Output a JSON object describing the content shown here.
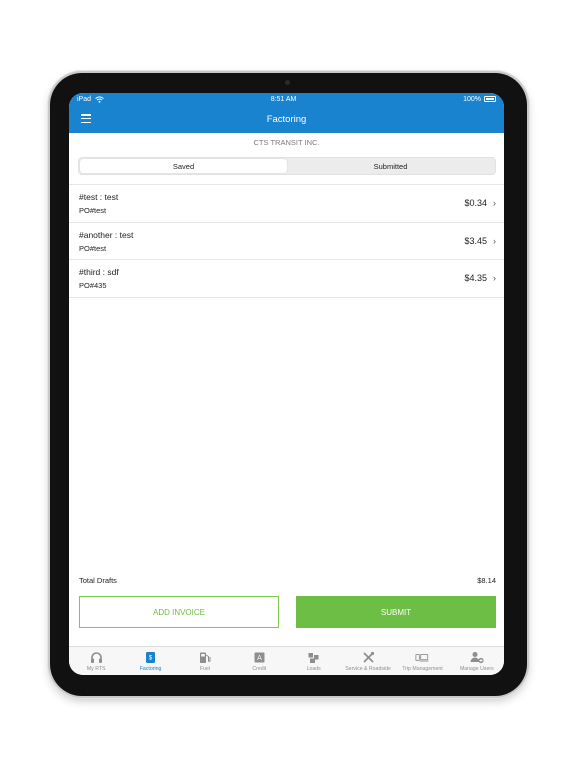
{
  "status_bar": {
    "carrier": "iPad",
    "time": "8:51 AM",
    "battery": "100%"
  },
  "nav": {
    "title": "Factoring"
  },
  "company": "CTS TRANSIT INC.",
  "segments": [
    {
      "label": "Saved",
      "active": true
    },
    {
      "label": "Submitted",
      "active": false
    }
  ],
  "invoices": [
    {
      "title": "#test :  test",
      "po": "PO#test",
      "amount": "$0.34"
    },
    {
      "title": "#another :  test",
      "po": "PO#test",
      "amount": "$3.45"
    },
    {
      "title": "#third :  sdf",
      "po": "PO#435",
      "amount": "$4.35"
    }
  ],
  "totals": {
    "label": "Total Drafts",
    "value": "$8.14"
  },
  "buttons": {
    "add_invoice": "ADD INVOICE",
    "submit": "SUBMIT"
  },
  "tabs": [
    {
      "label": "My RTS",
      "icon": "headset-icon",
      "active": false
    },
    {
      "label": "Factoring",
      "icon": "factoring-icon",
      "active": true
    },
    {
      "label": "Fuel",
      "icon": "fuel-pump-icon",
      "active": false
    },
    {
      "label": "Credit",
      "icon": "credit-icon",
      "active": false
    },
    {
      "label": "Loads",
      "icon": "loads-icon",
      "active": false
    },
    {
      "label": "Service & Roadside",
      "icon": "tools-icon",
      "active": false
    },
    {
      "label": "Trip Management",
      "icon": "trip-icon",
      "active": false
    },
    {
      "label": "Manage Users",
      "icon": "add-user-icon",
      "active": false
    }
  ],
  "colors": {
    "primary": "#1a83cf",
    "accent_green": "#6cbf44",
    "tab_inactive": "#8e8e8e"
  }
}
